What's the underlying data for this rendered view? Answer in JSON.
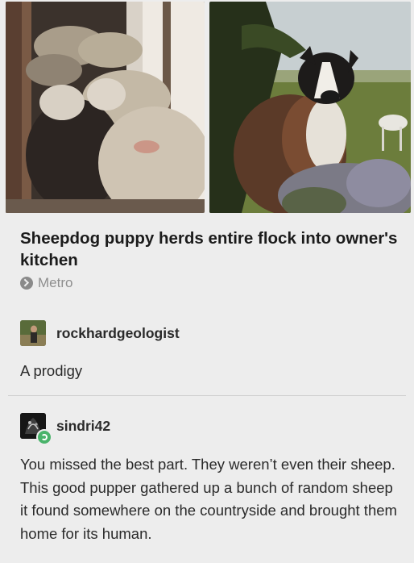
{
  "post": {
    "headline": "Sheepdog puppy herds entire flock into owner's kitchen",
    "source": "Metro"
  },
  "reblogs": [
    {
      "username": "rockhardgeologist",
      "text": "A prodigy"
    },
    {
      "username": "sindri42",
      "text": "You missed the best part. They weren’t even their sheep. This good pupper gathered up a bunch of random sheep it found somewhere on the countryside and brought them home for its human."
    }
  ]
}
